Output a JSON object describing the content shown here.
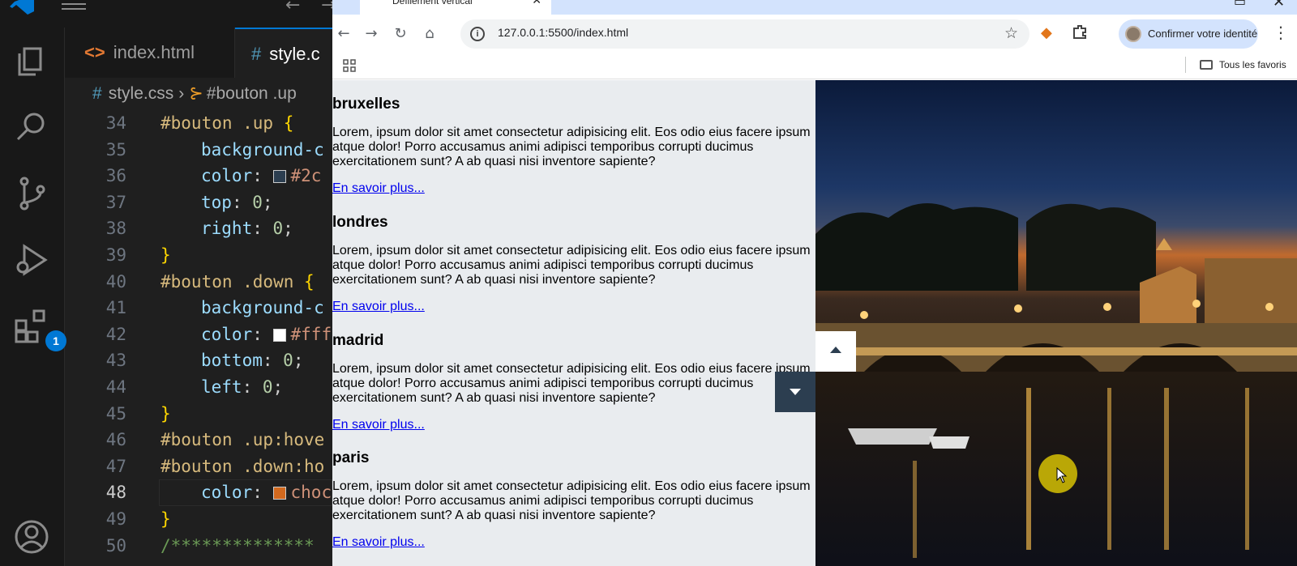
{
  "editor": {
    "tabs": [
      {
        "icon": "<>",
        "label": "index.html"
      },
      {
        "icon": "#",
        "label": "style.c"
      }
    ],
    "breadcrumb": {
      "file": "style.css",
      "symbol": "#bouton .up"
    },
    "badge_count": "1",
    "lines": [
      {
        "n": "34",
        "selector": "#bouton .up",
        "brace": " {"
      },
      {
        "n": "35",
        "prop": "background-c"
      },
      {
        "n": "36",
        "prop": "color",
        "value": "#2c"
      },
      {
        "n": "37",
        "prop": "top",
        "num": "0"
      },
      {
        "n": "38",
        "prop": "right",
        "num": "0"
      },
      {
        "n": "39",
        "brace": "}"
      },
      {
        "n": "40",
        "selector": "#bouton .down",
        "brace": " {"
      },
      {
        "n": "41",
        "prop": "background-c"
      },
      {
        "n": "42",
        "prop": "color",
        "value": "#fff"
      },
      {
        "n": "43",
        "prop": "bottom",
        "num": "0"
      },
      {
        "n": "44",
        "prop": "left",
        "num": "0"
      },
      {
        "n": "45",
        "brace": "}"
      },
      {
        "n": "46",
        "selector": "#bouton .up:hove"
      },
      {
        "n": "47",
        "selector": "#bouton .down:ho"
      },
      {
        "n": "48",
        "prop": "color",
        "value": "choc"
      },
      {
        "n": "49",
        "brace": "}"
      },
      {
        "n": "50",
        "comment": "/**************"
      }
    ],
    "swatches": {
      "line36": "#2c3e50",
      "line42": "#ffffff",
      "line48": "#d2691e"
    }
  },
  "browser": {
    "tab_title": "Défilement vertical",
    "url": "127.0.0.1:5500/index.html",
    "profile_label": "Confirmer votre identité",
    "bookmarks_all": "Tous les favoris"
  },
  "page": {
    "cities": [
      {
        "title": "bruxelles",
        "text": "Lorem, ipsum dolor sit amet consectetur adipisicing elit. Eos odio eius facere ipsum atque dolor! Porro accusamus animi adipisci temporibus corrupti ducimus exercitationem sunt? A ab quasi nisi inventore sapiente?",
        "link": "En savoir plus..."
      },
      {
        "title": "londres",
        "text": "Lorem, ipsum dolor sit amet consectetur adipisicing elit. Eos odio eius facere ipsum atque dolor! Porro accusamus animi adipisci temporibus corrupti ducimus exercitationem sunt? A ab quasi nisi inventore sapiente?",
        "link": "En savoir plus..."
      },
      {
        "title": "madrid",
        "text": "Lorem, ipsum dolor sit amet consectetur adipisicing elit. Eos odio eius facere ipsum atque dolor! Porro accusamus animi adipisci temporibus corrupti ducimus exercitationem sunt? A ab quasi nisi inventore sapiente?",
        "link": "En savoir plus..."
      },
      {
        "title": "paris",
        "text": "Lorem, ipsum dolor sit amet consectetur adipisicing elit. Eos odio eius facere ipsum atque dolor! Porro accusamus animi adipisci temporibus corrupti ducimus exercitationem sunt? A ab quasi nisi inventore sapiente?",
        "link": "En savoir plus..."
      }
    ]
  }
}
